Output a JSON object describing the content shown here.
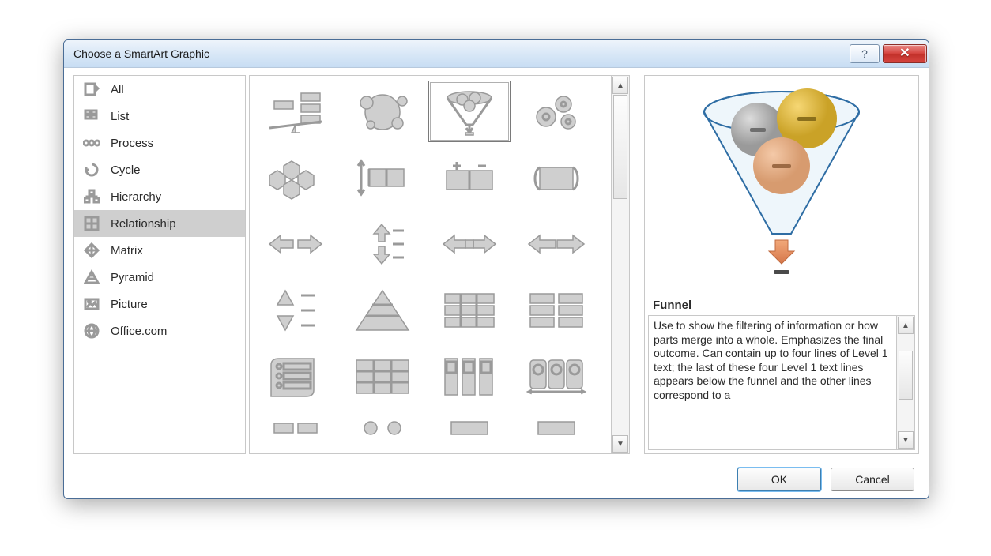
{
  "dialog": {
    "title": "Choose a SmartArt Graphic",
    "help_tooltip": "?",
    "close_tooltip": "x"
  },
  "categories": [
    {
      "id": "all",
      "label": "All",
      "icon": "all-icon"
    },
    {
      "id": "list",
      "label": "List",
      "icon": "list-icon"
    },
    {
      "id": "process",
      "label": "Process",
      "icon": "process-icon"
    },
    {
      "id": "cycle",
      "label": "Cycle",
      "icon": "cycle-icon"
    },
    {
      "id": "hierarchy",
      "label": "Hierarchy",
      "icon": "hierarchy-icon"
    },
    {
      "id": "relationship",
      "label": "Relationship",
      "icon": "relationship-icon",
      "selected": true
    },
    {
      "id": "matrix",
      "label": "Matrix",
      "icon": "matrix-icon"
    },
    {
      "id": "pyramid",
      "label": "Pyramid",
      "icon": "pyramid-icon"
    },
    {
      "id": "picture",
      "label": "Picture",
      "icon": "picture-icon"
    },
    {
      "id": "officecom",
      "label": "Office.com",
      "icon": "globe-icon"
    }
  ],
  "gallery": {
    "selected_index": 2,
    "items": [
      "balance",
      "circle-relationship",
      "funnel",
      "gears",
      "hexagon-cluster",
      "converging-arrows",
      "plus-minus",
      "opposing-ideas",
      "opposing-arrows",
      "diverging-arrows",
      "counterbalance-arrows",
      "arrow-ribbon",
      "stacked-venn",
      "basic-pyramid",
      "segmented-process",
      "grouped-list",
      "radial-list",
      "table-list",
      "vertical-box-list",
      "linear-venn",
      "segmented-pyramid",
      "basic-target",
      "nested-target",
      "continuous-picture"
    ]
  },
  "preview": {
    "name": "Funnel",
    "description": "Use to show the filtering of information or how parts merge into a whole. Emphasizes the final outcome. Can contain up to four lines of Level 1 text; the last of these four Level 1 text lines appears below the funnel and the other lines  correspond to a"
  },
  "footer": {
    "ok_label": "OK",
    "cancel_label": "Cancel"
  }
}
